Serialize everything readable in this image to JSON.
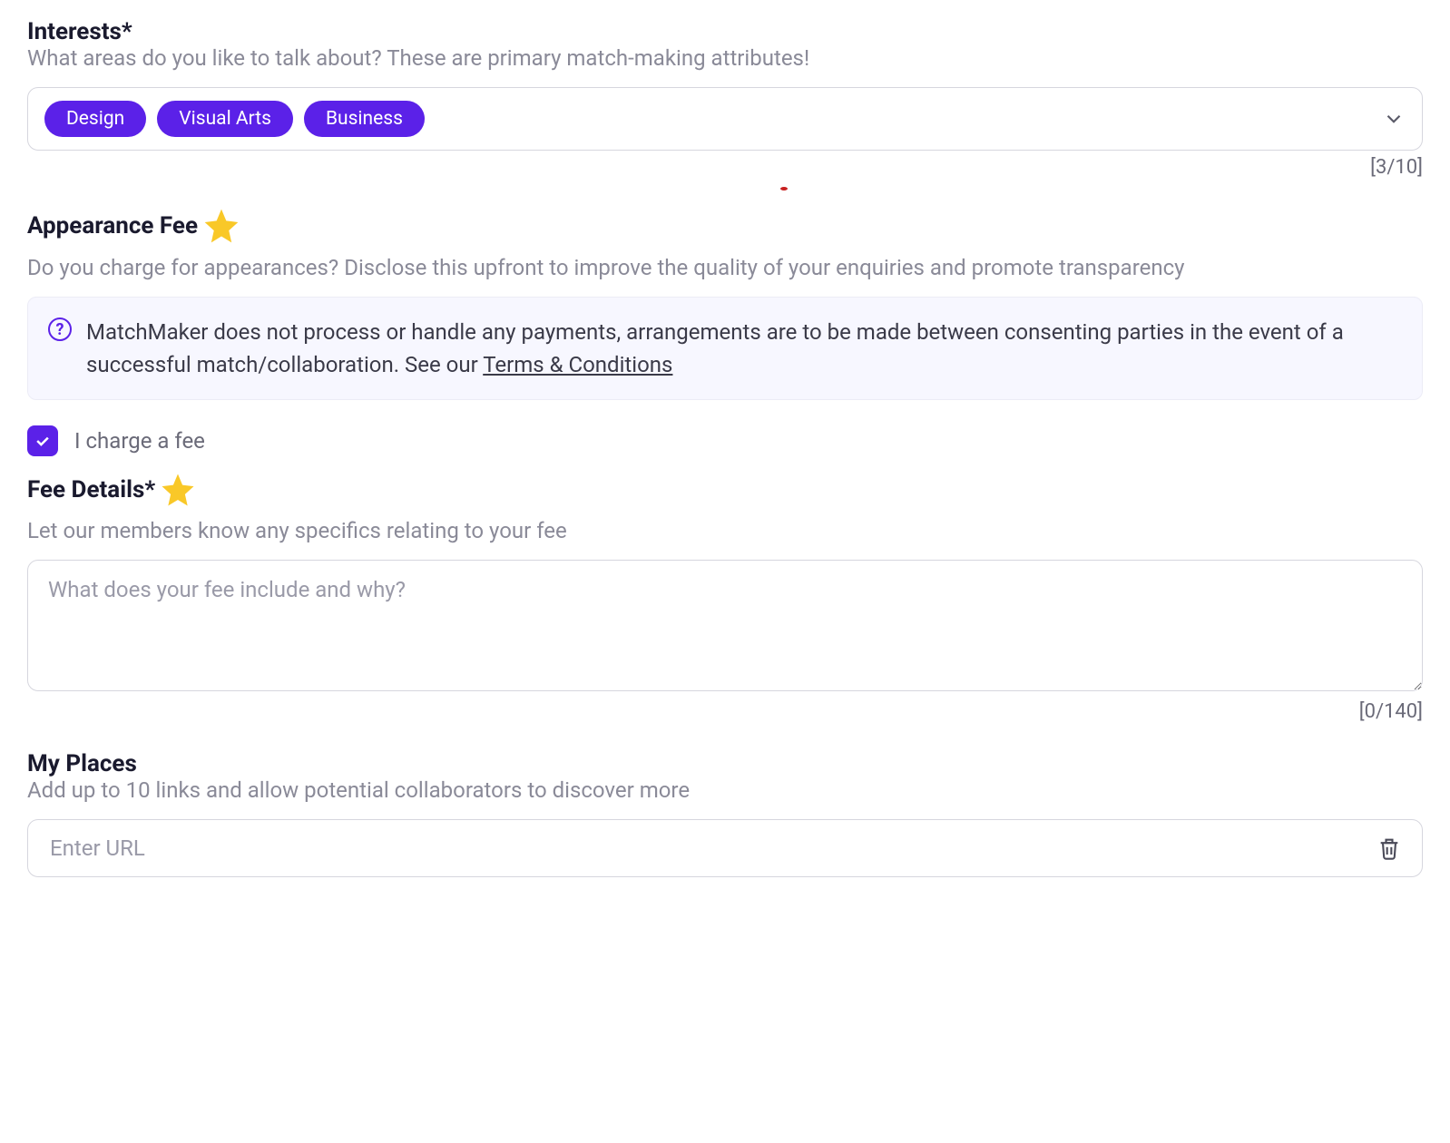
{
  "interests": {
    "title": "Interests*",
    "subtitle": "What areas do you like to talk about? These are primary match-making attributes!",
    "tags": [
      "Design",
      "Visual Arts",
      "Business"
    ],
    "counter": "[3/10]"
  },
  "appearance_fee": {
    "title": "Appearance Fee",
    "subtitle": "Do you charge for appearances? Disclose this upfront to improve the quality of your enquiries and promote transparency",
    "info_text_prefix": "MatchMaker does not process or handle any payments, arrangements are to be made between consenting parties in the event of a successful match/collaboration. See our ",
    "info_link_text": "Terms & Conditions",
    "checkbox_label": "I charge a fee",
    "checkbox_checked": true
  },
  "fee_details": {
    "title": "Fee Details*",
    "subtitle": "Let our members know any specifics relating to your fee",
    "placeholder": "What does your fee include and why?",
    "counter": "[0/140]"
  },
  "my_places": {
    "title": "My Places",
    "subtitle": "Add up to 10 links and allow potential collaborators to discover more",
    "url_placeholder": "Enter URL"
  }
}
